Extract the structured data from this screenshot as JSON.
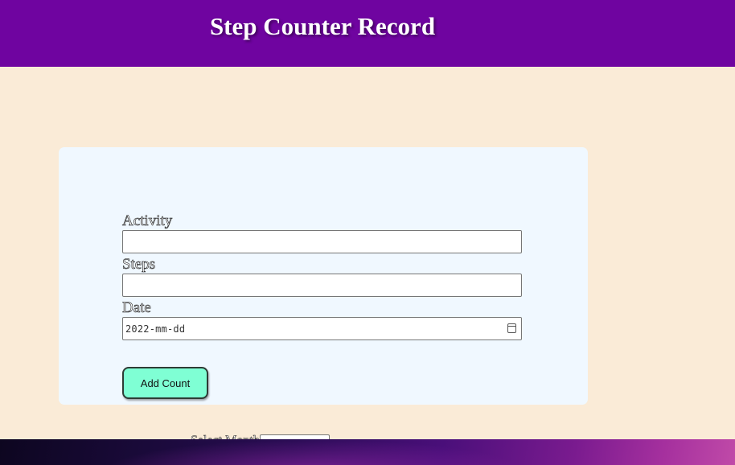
{
  "header": {
    "title": "Step Counter Record"
  },
  "form": {
    "activity": {
      "label": "Activity",
      "value": "",
      "placeholder": ""
    },
    "steps": {
      "label": "Steps",
      "value": "",
      "placeholder": ""
    },
    "date": {
      "label": "Date",
      "display": "2022-mm-dd"
    },
    "submit_label": "Add Count"
  },
  "month_filter": {
    "label": "Select Month",
    "selected": ""
  },
  "colors": {
    "header_bg": "#6f04a0",
    "page_bg": "#faebd7",
    "card_bg": "#f0f8ff",
    "button_bg": "#7fffd4"
  },
  "icons": {
    "date_picker": "calendar-icon"
  }
}
